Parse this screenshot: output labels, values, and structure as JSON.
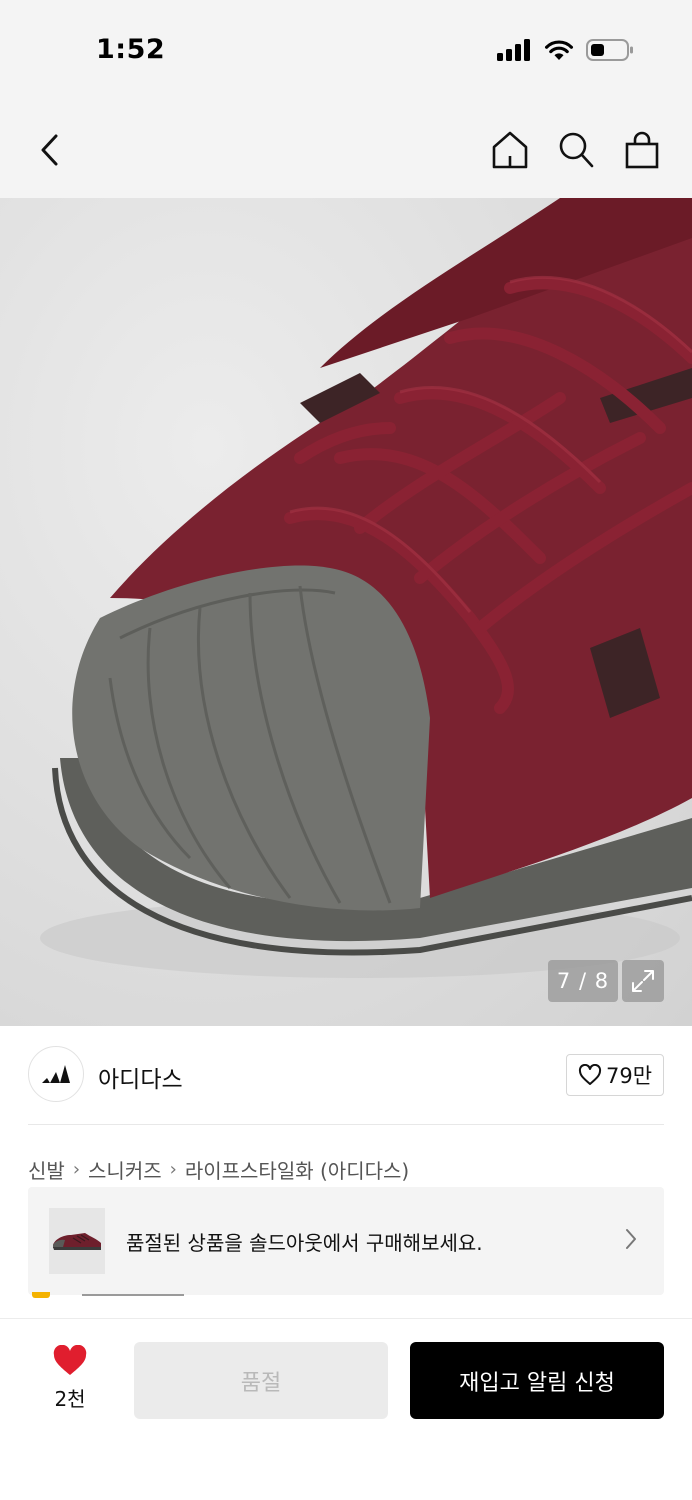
{
  "status_bar": {
    "time": "1:52"
  },
  "product": {
    "image_counter": "7 / 8"
  },
  "brand": {
    "name": "아디다스",
    "likes": "79만"
  },
  "breadcrumb": [
    "신발",
    "스니커즈",
    "라이프스타일화 (아디다스)"
  ],
  "soldout_banner": {
    "text": "품절된 상품을 솔드아웃에서 구매해보세요."
  },
  "bottom_bar": {
    "wish_count": "2천",
    "soldout_label": "품절",
    "restock_label": "재입고 알림 신청"
  },
  "colors": {
    "accent": "#e01e2e",
    "primary_button": "#000000",
    "disabled_button": "#ebebeb",
    "shoe_suede": "#7a2230",
    "shoe_toe": "#6f706c"
  }
}
